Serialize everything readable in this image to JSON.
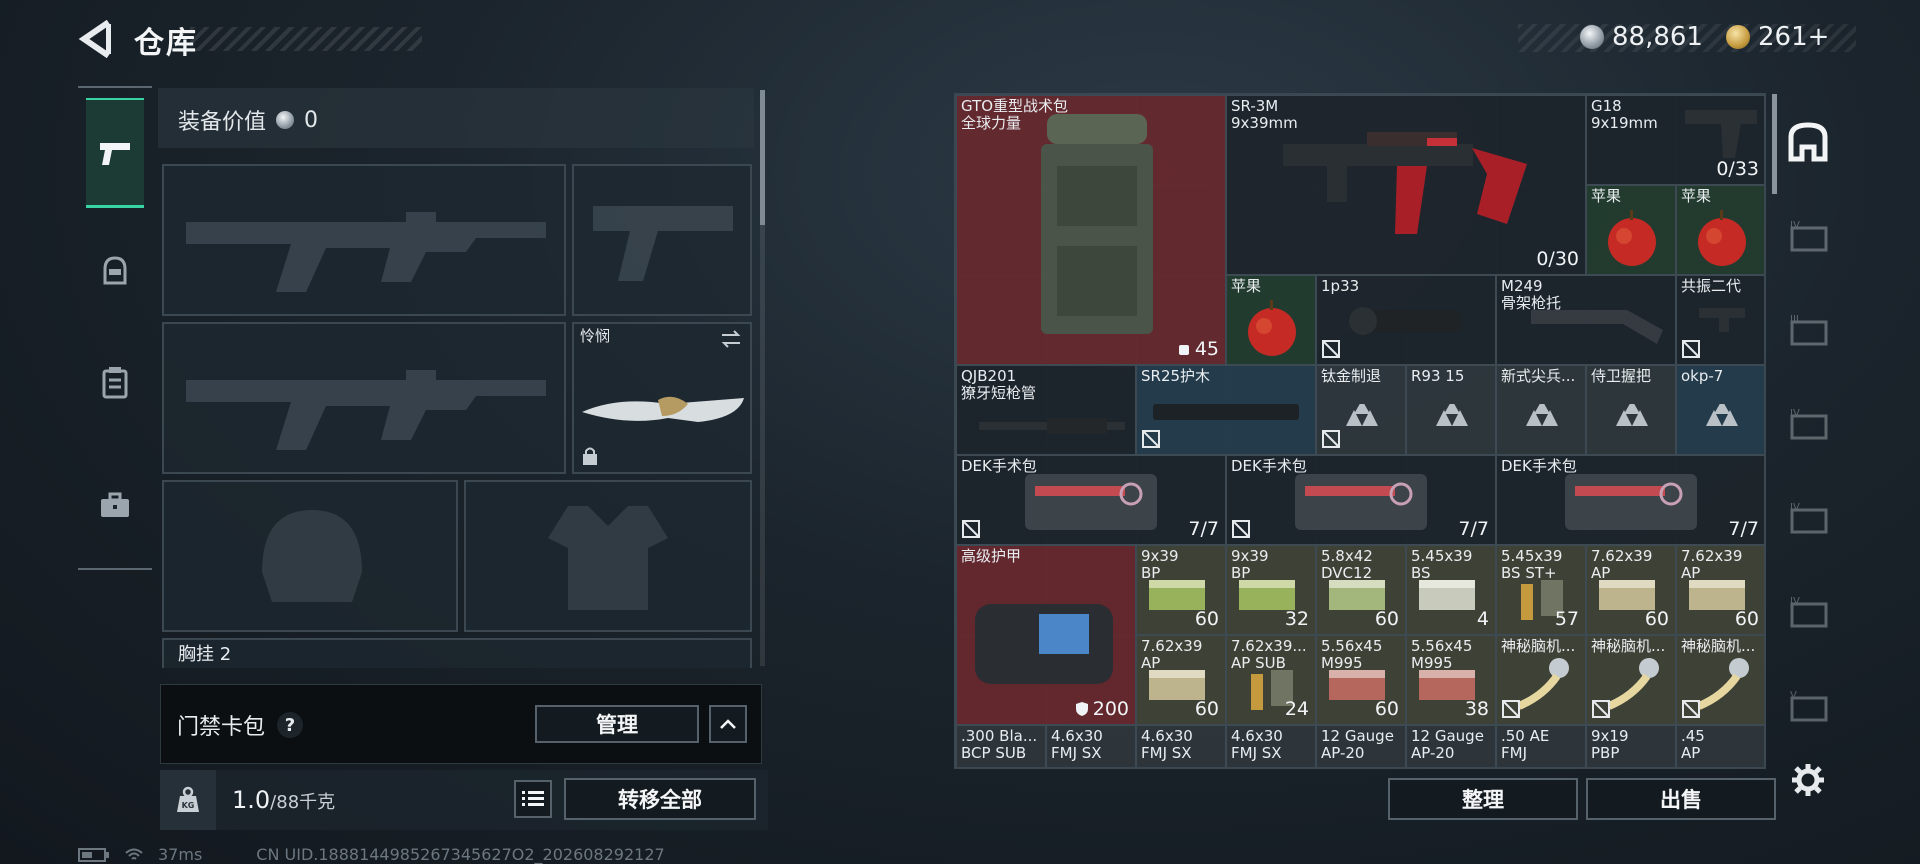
{
  "header": {
    "title": "仓库"
  },
  "currency": [
    {
      "icon": "silver-coin-icon",
      "value": "88,861"
    },
    {
      "icon": "gold-coin-icon",
      "value": "261+"
    }
  ],
  "tabs": [
    {
      "icon": "pistol-icon",
      "active": true
    },
    {
      "icon": "helmet-icon",
      "active": false
    },
    {
      "icon": "vest-icon",
      "active": false
    },
    {
      "icon": "briefcase-icon",
      "active": false
    }
  ],
  "equipment": {
    "value_label": "装备价值",
    "value": "0",
    "melee_name": "怜悯",
    "next_section": "胸挂",
    "next_section_count": "2"
  },
  "card_bag": {
    "label": "门禁卡包",
    "help": "?",
    "manage_label": "管理"
  },
  "weight": {
    "current": "1.0",
    "max": "/88千克",
    "transfer_label": "转移全部"
  },
  "status": {
    "ping": "37ms",
    "uid": "CN UID.1888144985267345627O2_202608292127"
  },
  "stash": {
    "items": [
      {
        "name": "GTO重型战术包\n全球力量",
        "count": "45",
        "color": "red"
      },
      {
        "name": "SR-3M\n9x39mm",
        "count": "0/30",
        "color": "dark"
      },
      {
        "name": "G18\n9x19mm",
        "count": "0/33",
        "color": "dark"
      },
      {
        "name": "苹果",
        "count": "",
        "color": "green"
      },
      {
        "name": "苹果",
        "count": "",
        "color": "green"
      },
      {
        "name": "苹果",
        "count": "",
        "color": "green"
      },
      {
        "name": "1p33",
        "count": "",
        "color": "dark"
      },
      {
        "name": "M249\n骨架枪托",
        "count": "",
        "color": "dark"
      },
      {
        "name": "共振二代",
        "count": "",
        "color": "dark"
      },
      {
        "name": "QJB201\n獠牙短枪管",
        "count": "",
        "color": "dark"
      },
      {
        "name": "SR25护木",
        "count": "",
        "color": "blue"
      },
      {
        "name": "钛金制退",
        "count": "",
        "color": "gray"
      },
      {
        "name": "R93 15",
        "count": "",
        "color": "gray"
      },
      {
        "name": "新式尖兵...",
        "count": "",
        "color": "gray"
      },
      {
        "name": "侍卫握把",
        "count": "",
        "color": "gray"
      },
      {
        "name": "okp-7",
        "count": "",
        "color": "blue"
      },
      {
        "name": "DEK手术包",
        "count": "7/7",
        "color": "dark"
      },
      {
        "name": "DEK手术包",
        "count": "7/7",
        "color": "dark"
      },
      {
        "name": "DEK手术包",
        "count": "7/7",
        "color": "dark"
      },
      {
        "name": "高级护甲",
        "count": "200",
        "color": "red"
      },
      {
        "name": "9x39\nBP",
        "count": "60",
        "color": "olive"
      },
      {
        "name": "9x39\nBP",
        "count": "32",
        "color": "olive"
      },
      {
        "name": "5.8x42\nDVC12",
        "count": "60",
        "color": "olive"
      },
      {
        "name": "5.45x39\nBS",
        "count": "4",
        "color": "olive"
      },
      {
        "name": "5.45x39\nBS ST+",
        "count": "57",
        "color": "olive"
      },
      {
        "name": "7.62x39\nAP",
        "count": "60",
        "color": "olive"
      },
      {
        "name": "7.62x39\nAP",
        "count": "60",
        "color": "olive"
      },
      {
        "name": "7.62x39\nAP",
        "count": "60",
        "color": "olive"
      },
      {
        "name": "7.62x39...\nAP SUB",
        "count": "24",
        "color": "olive"
      },
      {
        "name": "5.56x45\nM995",
        "count": "60",
        "color": "olive"
      },
      {
        "name": "5.56x45\nM995",
        "count": "38",
        "color": "olive"
      },
      {
        "name": "神秘脑机...",
        "count": "",
        "color": "olive"
      },
      {
        "name": "神秘脑机...",
        "count": "",
        "color": "olive"
      },
      {
        "name": "神秘脑机...",
        "count": "",
        "color": "olive"
      },
      {
        "name": ".300 Bla...\nBCP SUB",
        "count": "",
        "color": "gray"
      },
      {
        "name": "4.6x30\nFMJ SX",
        "count": "",
        "color": "gray"
      },
      {
        "name": "4.6x30\nFMJ SX",
        "count": "",
        "color": "gray"
      },
      {
        "name": "4.6x30\nFMJ SX",
        "count": "",
        "color": "gray"
      },
      {
        "name": "12 Gauge\nAP-20",
        "count": "",
        "color": "gray"
      },
      {
        "name": "12 Gauge\nAP-20",
        "count": "",
        "color": "gray"
      },
      {
        "name": ".50 AE\nFMJ",
        "count": "",
        "color": "gray"
      },
      {
        "name": "9x19\nPBP",
        "count": "",
        "color": "gray"
      },
      {
        "name": ".45\nAP",
        "count": "",
        "color": "gray"
      }
    ]
  },
  "actions": {
    "sort_label": "整理",
    "sell_label": "出售"
  },
  "colors": {
    "accent": "#39d3a3",
    "rare_red": "#702a30",
    "panel": "#1e262c"
  }
}
